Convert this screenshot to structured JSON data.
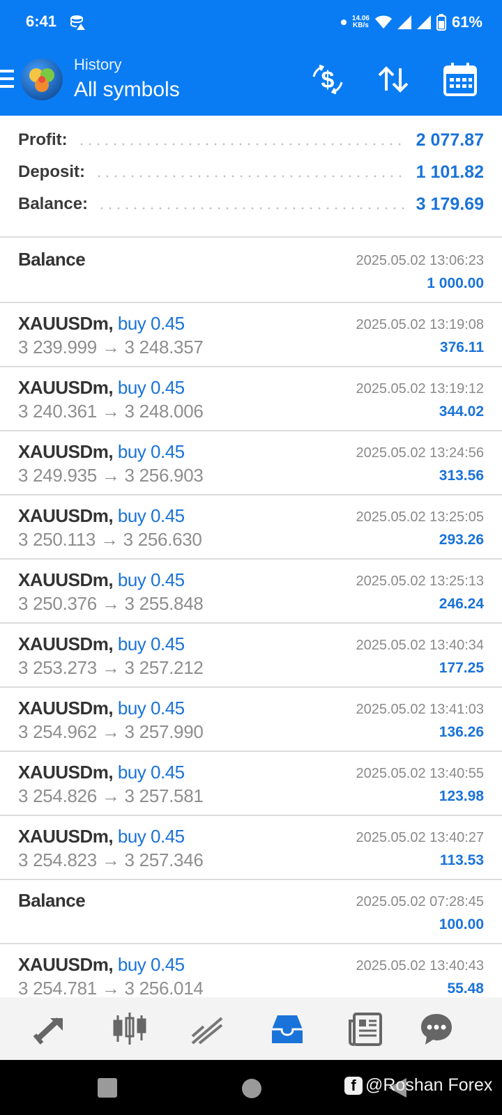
{
  "status_bar": {
    "time": "6:41",
    "net_speed_value": "14.06",
    "net_speed_unit": "KB/s",
    "battery": "61%"
  },
  "app_bar": {
    "subtitle": "History",
    "title": "All symbols"
  },
  "summary": {
    "profit_label": "Profit:",
    "profit_value": "2 077.87",
    "deposit_label": "Deposit:",
    "deposit_value": "1 101.82",
    "balance_label": "Balance:",
    "balance_value": "3 179.69"
  },
  "history": [
    {
      "type": "balance",
      "symbol": "Balance",
      "time": "2025.05.02 13:06:23",
      "amount": "1 000.00"
    },
    {
      "type": "deal",
      "symbol": "XAUUSDm,",
      "side": "buy 0.45",
      "open": "3 239.999",
      "close": "3 248.357",
      "time": "2025.05.02 13:19:08",
      "amount": "376.11"
    },
    {
      "type": "deal",
      "symbol": "XAUUSDm,",
      "side": "buy 0.45",
      "open": "3 240.361",
      "close": "3 248.006",
      "time": "2025.05.02 13:19:12",
      "amount": "344.02"
    },
    {
      "type": "deal",
      "symbol": "XAUUSDm,",
      "side": "buy 0.45",
      "open": "3 249.935",
      "close": "3 256.903",
      "time": "2025.05.02 13:24:56",
      "amount": "313.56"
    },
    {
      "type": "deal",
      "symbol": "XAUUSDm,",
      "side": "buy 0.45",
      "open": "3 250.113",
      "close": "3 256.630",
      "time": "2025.05.02 13:25:05",
      "amount": "293.26"
    },
    {
      "type": "deal",
      "symbol": "XAUUSDm,",
      "side": "buy 0.45",
      "open": "3 250.376",
      "close": "3 255.848",
      "time": "2025.05.02 13:25:13",
      "amount": "246.24"
    },
    {
      "type": "deal",
      "symbol": "XAUUSDm,",
      "side": "buy 0.45",
      "open": "3 253.273",
      "close": "3 257.212",
      "time": "2025.05.02 13:40:34",
      "amount": "177.25"
    },
    {
      "type": "deal",
      "symbol": "XAUUSDm,",
      "side": "buy 0.45",
      "open": "3 254.962",
      "close": "3 257.990",
      "time": "2025.05.02 13:41:03",
      "amount": "136.26"
    },
    {
      "type": "deal",
      "symbol": "XAUUSDm,",
      "side": "buy 0.45",
      "open": "3 254.826",
      "close": "3 257.581",
      "time": "2025.05.02 13:40:55",
      "amount": "123.98"
    },
    {
      "type": "deal",
      "symbol": "XAUUSDm,",
      "side": "buy 0.45",
      "open": "3 254.823",
      "close": "3 257.346",
      "time": "2025.05.02 13:40:27",
      "amount": "113.53"
    },
    {
      "type": "balance",
      "symbol": "Balance",
      "time": "2025.05.02 07:28:45",
      "amount": "100.00"
    },
    {
      "type": "deal",
      "symbol": "XAUUSDm,",
      "side": "buy 0.45",
      "open": "3 254.781",
      "close": "3 256.014",
      "time": "2025.05.02 13:40:43",
      "amount": "55.48"
    }
  ],
  "arrow_glyph": "→",
  "bottom_nav": {
    "items": [
      "trade",
      "quotes",
      "chart",
      "history",
      "news",
      "chat"
    ],
    "active": "history"
  },
  "watermark": {
    "badge": "f",
    "text": "@Roshan Forex"
  },
  "colors": {
    "app_bar": "#0a7cf3",
    "accent": "#1a73d8",
    "bottom_nav_bg": "#f3f3f3"
  }
}
